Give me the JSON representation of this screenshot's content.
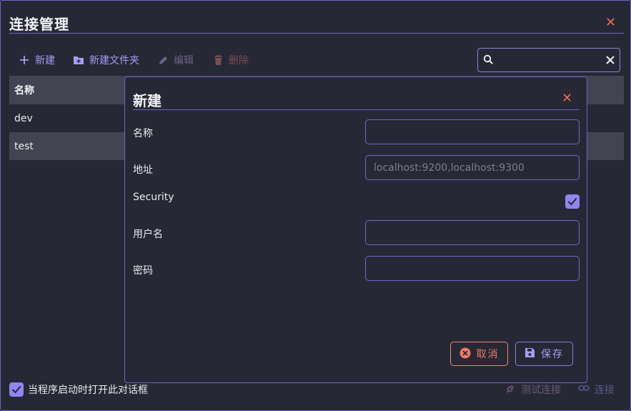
{
  "window": {
    "title": "连接管理"
  },
  "toolbar": {
    "new_label": "新建",
    "new_folder_label": "新建文件夹",
    "edit_label": "编辑",
    "delete_label": "删除"
  },
  "search": {
    "value": "",
    "placeholder": ""
  },
  "table": {
    "column_header": "名称",
    "rows": [
      {
        "name": "dev"
      },
      {
        "name": "test"
      }
    ]
  },
  "footer": {
    "open_on_start_label": "当程序启动时打开此对话框",
    "open_on_start_checked": true,
    "test_connection_label": "测试连接",
    "connect_label": "连接"
  },
  "dialog": {
    "title": "新建",
    "fields": {
      "name_label": "名称",
      "name_value": "",
      "address_label": "地址",
      "address_placeholder": "localhost:9200,localhost:9300",
      "security_label": "Security",
      "security_checked": true,
      "username_label": "用户名",
      "username_value": "",
      "password_label": "密码",
      "password_value": ""
    },
    "cancel_label": "取消",
    "save_label": "保存"
  },
  "colors": {
    "accent": "#8f86f0",
    "danger": "#ef6b55",
    "background": "#272835",
    "border": "#6a64c6"
  }
}
